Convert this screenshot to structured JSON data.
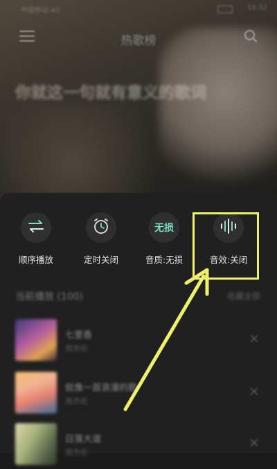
{
  "status_bar": {
    "carrier": "中国移动 4G",
    "time": "16:52"
  },
  "header": {
    "title": "热歌榜"
  },
  "background": {
    "headline": "你就这一句就有意义的歌词"
  },
  "actions": [
    {
      "label": "顺序播放",
      "icon": "sequential-play-icon"
    },
    {
      "label": "定时关闭",
      "icon": "alarm-clock-icon"
    },
    {
      "label": "音质:无损",
      "icon": "lossless-badge",
      "icon_text": "无损"
    },
    {
      "label": "音效:关闭",
      "icon": "sound-wave-icon"
    }
  ],
  "playlist": {
    "title": "当前播放 (100)",
    "right_action": "收藏全部",
    "songs": [
      {
        "title": "七里香",
        "artist": "周杰伦"
      },
      {
        "title": "就像一首浪漫的歌",
        "artist": "周杰伦"
      },
      {
        "title": "日落大道",
        "artist": "周杰伦"
      }
    ]
  },
  "colors": {
    "accent": "#7bdcc4",
    "annotation": "#eef26a",
    "sheet_background": "#202020",
    "icon_circle": "#2f2f2f"
  }
}
